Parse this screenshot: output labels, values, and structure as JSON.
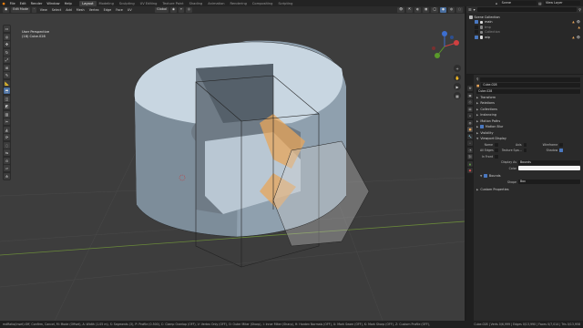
{
  "topbar": {
    "menus": [
      "File",
      "Edit",
      "Render",
      "Window",
      "Help"
    ],
    "workspaces": [
      "Layout",
      "Modeling",
      "Sculpting",
      "UV Editing",
      "Texture Paint",
      "Shading",
      "Animation",
      "Rendering",
      "Compositing",
      "Scripting"
    ],
    "active_workspace": "Layout",
    "scene": "Scene",
    "view_layer": "View Layer"
  },
  "viewport_header": {
    "mode": "Edit Mode",
    "menus": [
      "View",
      "Select",
      "Add",
      "Mesh",
      "Vertex",
      "Edge",
      "Face",
      "UV"
    ],
    "orientation": "Global"
  },
  "viewport": {
    "view_name": "User Perspective",
    "object_info": "(18) Cube.028"
  },
  "toolbar": {
    "icons": [
      "select-box-icon",
      "cursor-icon",
      "move-icon",
      "rotate-icon",
      "scale-icon",
      "transform-icon",
      "annotate-icon",
      "measure-icon",
      "extrude-icon",
      "inset-icon",
      "bevel-icon",
      "loop-cut-icon",
      "knife-icon",
      "poly-build-icon",
      "spin-icon",
      "smooth-icon",
      "edge-slide-icon",
      "shrink-icon",
      "shear-icon",
      "rip-icon"
    ],
    "active_index": 8
  },
  "outliner": {
    "search_placeholder": "",
    "rows": [
      {
        "label": "Scene Collection",
        "color": "#cccccc",
        "indent": 0
      },
      {
        "label": "main",
        "color": "#e8e8e8",
        "indent": 1
      },
      {
        "label": "tmp",
        "color": "#888888",
        "indent": 1
      },
      {
        "label": "Collection",
        "color": "#888888",
        "indent": 1
      },
      {
        "label": "wip",
        "color": "#e8e8e8",
        "indent": 1
      }
    ]
  },
  "properties": {
    "object_name": "Cube.028",
    "data_name": "Cube.028",
    "sections": [
      "Transform",
      "Relations",
      "Collections",
      "Instancing",
      "Motion Paths",
      "Motion Blur",
      "Visibility",
      "Viewport Display"
    ],
    "viewport_display": {
      "name_label": "Name",
      "axis_label": "Axis",
      "wireframe_label": "Wireframe",
      "all_edges_label": "All Edges",
      "texture_space_label": "Texture Spa...",
      "shadow_label": "Shadow",
      "in_front_label": "In Front",
      "display_as_label": "Display As",
      "display_as_value": "Bounds",
      "color_label": "Color",
      "bounds_label": "Bounds",
      "shape_label": "Shape",
      "shape_value": "Box"
    },
    "custom_properties": "Custom Properties"
  },
  "statusbar": {
    "left": "mdRatio(Inset):Off, Confirm, Cancel, M: Mode (Offset), A: Width (1.05 m), S: Segments (3), P: Profile (0.500), C: Clamp Overlap (OFF), V: Vertex Only (OFF), O: Outer Miter (Sharp), I: Inner Miter (Sharp), H: Harden Normals (OFF), U: Mark Seam (OFF), K: Mark Sharp (OFF), Z: Custom Profile (OFF), N: Intersection Grid (Sel)",
    "right": "Cube.028 | Verts 0/6,999 | Edges 0/13,990 | Faces 0/7,014 | Tris 0/13,958"
  }
}
